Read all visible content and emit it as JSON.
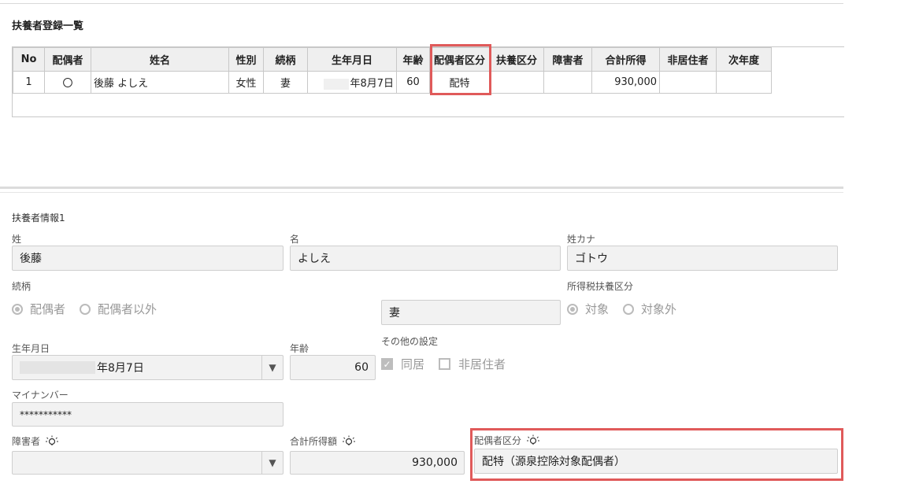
{
  "list": {
    "title": "扶養者登録一覧",
    "columns": [
      "No",
      "配偶者",
      "姓名",
      "性別",
      "続柄",
      "生年月日",
      "年齢",
      "配偶者区分",
      "扶養区分",
      "障害者",
      "合計所得",
      "非居住者",
      "次年度"
    ],
    "rows": [
      {
        "no": "1",
        "spouse": "〇",
        "name": "後藤 よしえ",
        "gender": "女性",
        "relation": "妻",
        "birthdate": "年8月7日",
        "age": "60",
        "spouse_class": "配特",
        "dependent_class": "",
        "disability": "",
        "total_income": "930,000",
        "nonresident": "",
        "next_year": ""
      }
    ]
  },
  "form": {
    "section_title": "扶養者情報1",
    "last_name": {
      "label": "姓",
      "value": "後藤"
    },
    "first_name": {
      "label": "名",
      "value": "よしえ"
    },
    "last_name_kana": {
      "label": "姓カナ",
      "value": "ゴトウ"
    },
    "relation": {
      "label": "続柄",
      "options": [
        "配偶者",
        "配偶者以外"
      ],
      "selected": "配偶者",
      "value": "妻"
    },
    "tax_dependent": {
      "label": "所得税扶養区分",
      "options": [
        "対象",
        "対象外"
      ],
      "selected": "対象"
    },
    "birthdate": {
      "label": "生年月日",
      "value": "年8月7日"
    },
    "age": {
      "label": "年齢",
      "value": "60"
    },
    "other_settings": {
      "label": "その他の設定",
      "cohabiting": {
        "label": "同居",
        "checked": true
      },
      "nonresident": {
        "label": "非居住者",
        "checked": false
      }
    },
    "my_number": {
      "label": "マイナンバー",
      "value": "***********"
    },
    "disability": {
      "label": "障害者",
      "value": ""
    },
    "total_income": {
      "label": "合計所得額",
      "value": "930,000"
    },
    "spouse_class": {
      "label": "配偶者区分",
      "value": "配特（源泉控除対象配偶者）"
    }
  },
  "colors": {
    "highlight": "#e05a5a",
    "field_bg": "#f2f2f2",
    "header_bg": "#efefef"
  }
}
